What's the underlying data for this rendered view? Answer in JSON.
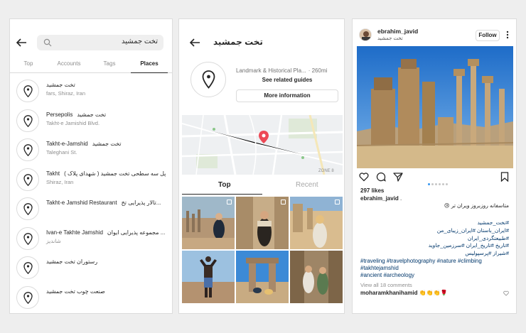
{
  "search_panel": {
    "query": "تخت جمشید",
    "tabs": [
      "Top",
      "Accounts",
      "Tags",
      "Places"
    ],
    "active_tab": "Places",
    "places": [
      {
        "title": "تخت جمشید",
        "title_fa": "",
        "subtitle": "fars, Shiraz, Iran"
      },
      {
        "title": "Persepolis",
        "title_fa": "تخت جمشید",
        "subtitle": "Takht-e Jamishid Blvd."
      },
      {
        "title": "Takht-e-Jamshid",
        "title_fa": "تخت جمشید",
        "subtitle": "Taleghani St."
      },
      {
        "title": "Takht",
        "title_fa": "پل سه سطحی تخت جمشید ( شهدای پلاک )",
        "subtitle": "Shiraz, Iran"
      },
      {
        "title": "Takht-e Jamshid Restaurant",
        "title_fa": "تالار پذیرایی تخ...",
        "subtitle": ""
      },
      {
        "title": "Ivan-e Takhte Jamshid",
        "title_fa": "مجموعه پذیرایی ایوان ...",
        "subtitle": "شاندیز"
      },
      {
        "title": "رستوران تخت جمشید",
        "title_fa": "",
        "subtitle": ""
      },
      {
        "title": "صنعت چوب تخت جمشید",
        "title_fa": "",
        "subtitle": ""
      }
    ]
  },
  "place_panel": {
    "title": "تخت جمشید",
    "category": "Landmark & Historical Pla...",
    "distance": "· 260mi",
    "guides_label": "See related guides",
    "more_info_label": "More information",
    "map_label": "ZONE 8",
    "tabs": [
      "Top",
      "Recent"
    ],
    "active_tab": "Top"
  },
  "post_panel": {
    "username": "ebrahim_javid",
    "location": "تخت جمشید",
    "follow_label": "Follow",
    "likes": "297 likes",
    "caption_user": "ebrahim_javid",
    "caption_user_suffix": ".",
    "caption_fa": "متاسفانه روزبروز ویران تر 😢",
    "hashtags_fa": [
      "#تخت_جمشید",
      "#ایران_باستان #ایران_زیبای_من",
      "#طبیعتگردی_ایران",
      "#تاریخ #تاریخ_ایران #سرزمین_جاوید",
      "#شیراز #پرسپولیس"
    ],
    "hashtags_en": [
      "#traveling #travelphotography #nature #climbing",
      "#takhtejamshid",
      "#ancient #archeology"
    ],
    "comments_link": "View all 18 comments",
    "comment_user": "moharamkhanihamid",
    "comment_text": "👏👏👏🌹"
  },
  "colors": {
    "link": "#00376b",
    "accent": "#3897f0",
    "pin": "#ed4956"
  }
}
